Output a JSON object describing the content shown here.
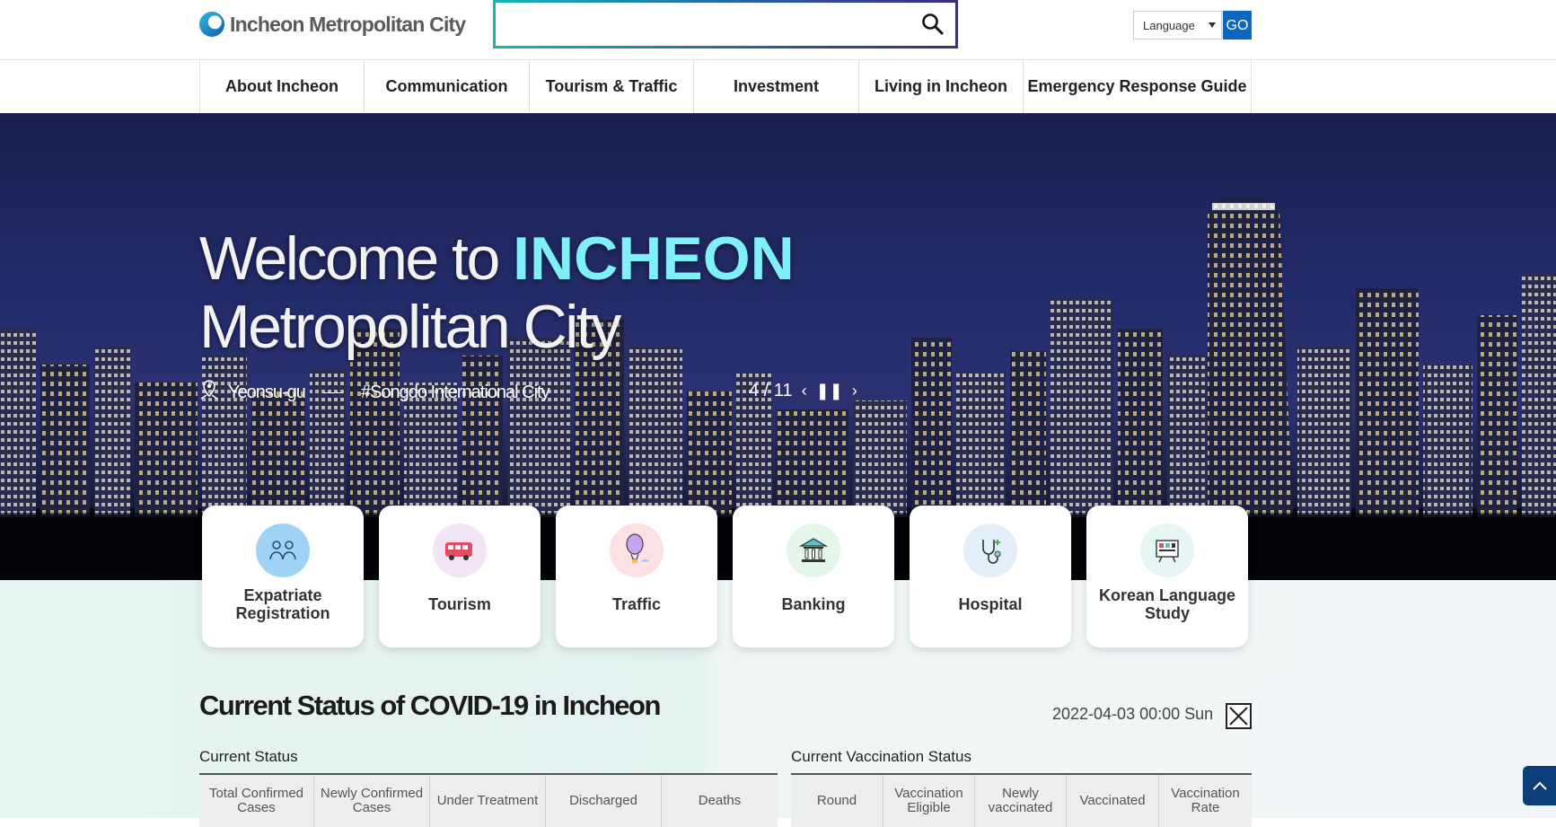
{
  "header": {
    "logo_text": "Incheon Metropolitan City",
    "search_placeholder": "",
    "language_label": "Language",
    "go_label": "GO"
  },
  "nav": {
    "items": [
      {
        "label": "About Incheon"
      },
      {
        "label": "Communication"
      },
      {
        "label": "Tourism & Traffic"
      },
      {
        "label": "Investment"
      },
      {
        "label": "Living in Incheon"
      },
      {
        "label": "Emergency Response Guide"
      }
    ]
  },
  "hero": {
    "title_line1_a": "Welcome to ",
    "title_line1_b": "INCHEON",
    "title_line2": "Metropolitan City",
    "location": "Yeonsu-gu",
    "hashtag": "#Songdo International City",
    "slide_counter": "4 / 11"
  },
  "quick_links": [
    {
      "label": "Expatriate Registration",
      "icon": "people-icon",
      "color": "#9fd3f5"
    },
    {
      "label": "Tourism",
      "icon": "bus-icon",
      "color": "#f2e3f5"
    },
    {
      "label": "Traffic",
      "icon": "balloon-icon",
      "color": "#fbe1e3"
    },
    {
      "label": "Banking",
      "icon": "bank-icon",
      "color": "#e4f5ea"
    },
    {
      "label": "Hospital",
      "icon": "stethoscope-icon",
      "color": "#e3eefb"
    },
    {
      "label": "Korean Language Study",
      "icon": "language-board-icon",
      "color": "#e6f6f4"
    }
  ],
  "covid": {
    "title": "Current Status of COVID-19 in Incheon",
    "date": "2022-04-03 00:00 Sun",
    "status": {
      "title": "Current Status",
      "columns": [
        "Total Confirmed Cases",
        "Newly Confirmed Cases",
        "Under Treatment",
        "Discharged",
        "Deaths"
      ]
    },
    "vaccination": {
      "title": "Current Vaccination Status",
      "columns": [
        "Round",
        "Vaccination Eligible",
        "Newly vaccinated",
        "Vaccinated",
        "Vaccination Rate"
      ]
    }
  }
}
